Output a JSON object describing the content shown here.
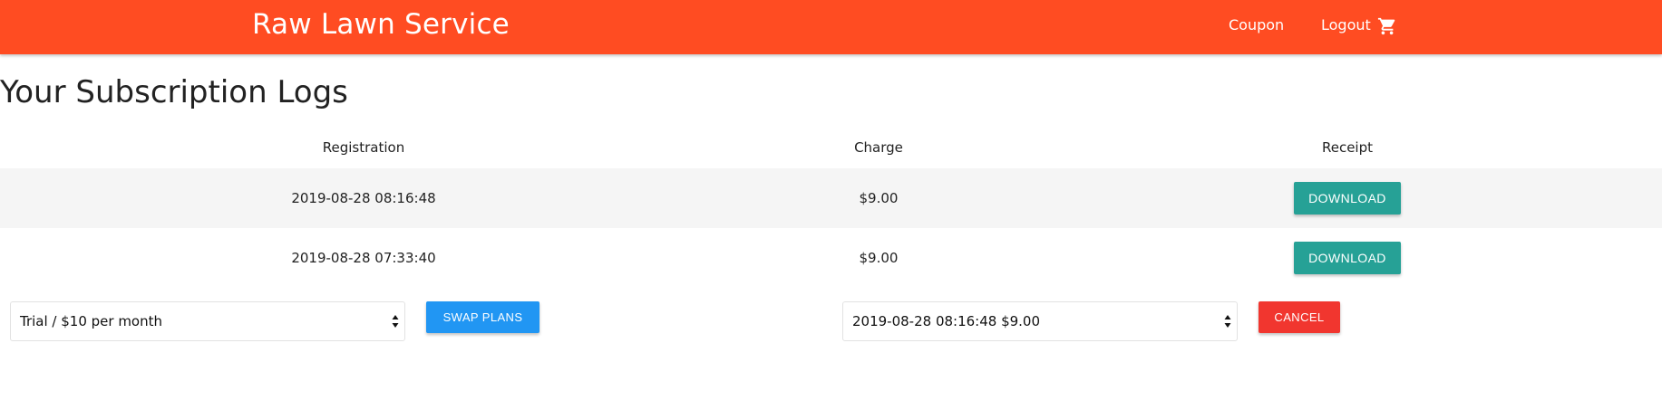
{
  "nav": {
    "brand": "Raw Lawn Service",
    "coupon": "Coupon",
    "logout": "Logout",
    "cart_icon": "cart-icon"
  },
  "page": {
    "title": "Your Subscription Logs"
  },
  "table": {
    "headers": [
      "Registration",
      "Charge",
      "Receipt"
    ],
    "rows": [
      {
        "registration": "2019-08-28 08:16:48",
        "charge": "$9.00",
        "action": "DOWNLOAD"
      },
      {
        "registration": "2019-08-28 07:33:40",
        "charge": "$9.00",
        "action": "DOWNLOAD"
      }
    ]
  },
  "controls": {
    "plan_select": "Trial / $10 per month",
    "swap_label": "SWAP PLANS",
    "charge_select": "2019-08-28 08:16:48 $9.00",
    "cancel_label": "CANCEL"
  },
  "colors": {
    "navbar": "#ff4c22",
    "download": "#26a196",
    "swap": "#2196f3",
    "cancel": "#f1362f"
  }
}
